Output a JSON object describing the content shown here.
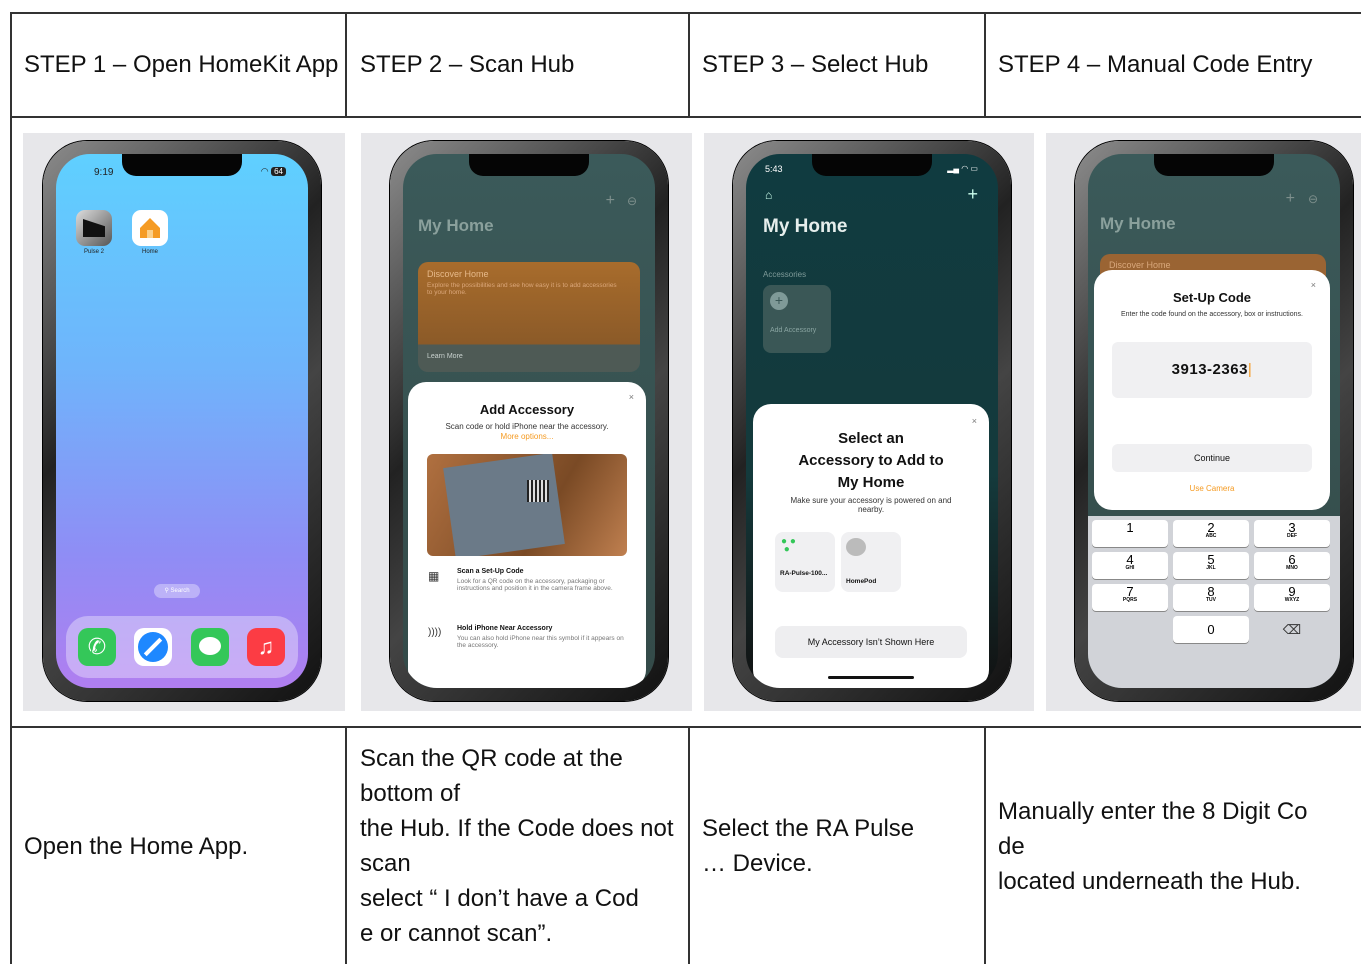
{
  "headers": [
    "STEP 1 – Open HomeKit App",
    "STEP 2 – Scan Hub",
    "STEP 3 – Select Hub",
    "STEP 4 – Manual Code Entry"
  ],
  "descriptions": {
    "step1": [
      "Open the Home App."
    ],
    "step2": [
      "Scan the QR code at the bottom of",
      "the Hub. If the Code does not scan",
      "select “ I don’t have a Cod",
      "e or cannot scan”."
    ],
    "step3": [
      "Select the RA Pulse",
      "… Device."
    ],
    "step4": [
      "Manually enter the 8 Digit Co",
      "de",
      "located underneath the Hub."
    ]
  },
  "phone1": {
    "time": "9:19",
    "battery": "64",
    "apps": [
      "Pulse 2",
      "Home"
    ],
    "search": "Search",
    "dock_icons": [
      "phone-icon",
      "safari-icon",
      "messages-icon",
      "music-icon"
    ]
  },
  "phone2": {
    "home_title": "My Home",
    "discover_title": "Discover Home",
    "discover_text": "Explore the possibilities and see how easy it is to add accessories to your home.",
    "learn_more": "Learn More",
    "sheet_title": "Add Accessory",
    "sheet_sub": "Scan code or hold iPhone near the accessory.",
    "more_options": "More options...",
    "scan_title": "Scan a Set-Up Code",
    "scan_text": "Look for a QR code on the accessory, packaging or instructions and position it in the camera frame above.",
    "nfc_title": "Hold iPhone Near Accessory",
    "nfc_text": "You can also hold iPhone near this symbol if it appears on the accessory."
  },
  "phone3": {
    "time": "5:43",
    "home_title": "My Home",
    "accessories": "Accessories",
    "add_accessory": "Add Accessory",
    "sheet_title_lines": [
      "Select an",
      "Accessory to Add to",
      "My Home"
    ],
    "sheet_sub": "Make sure your accessory is powered on and nearby.",
    "device1": "RA-Pulse-100...",
    "device2": "HomePod",
    "not_shown": "My Accessory Isn’t Shown Here"
  },
  "phone4": {
    "home_title": "My Home",
    "discover_title": "Discover Home",
    "title": "Set-Up Code",
    "sub": "Enter the code found on the accessory, box or instructions.",
    "code": "3913-2363",
    "continue": "Continue",
    "use_camera": "Use Camera",
    "keys": [
      {
        "n": "1",
        "l": ""
      },
      {
        "n": "2",
        "l": "ABC"
      },
      {
        "n": "3",
        "l": "DEF"
      },
      {
        "n": "4",
        "l": "GHI"
      },
      {
        "n": "5",
        "l": "JKL"
      },
      {
        "n": "6",
        "l": "MNO"
      },
      {
        "n": "7",
        "l": "PQRS"
      },
      {
        "n": "8",
        "l": "TUV"
      },
      {
        "n": "9",
        "l": "WXYZ"
      },
      {
        "n": "0",
        "l": ""
      }
    ]
  },
  "colors": {
    "accent_orange": "#f59b23",
    "teal_dark": "#153a3e"
  }
}
